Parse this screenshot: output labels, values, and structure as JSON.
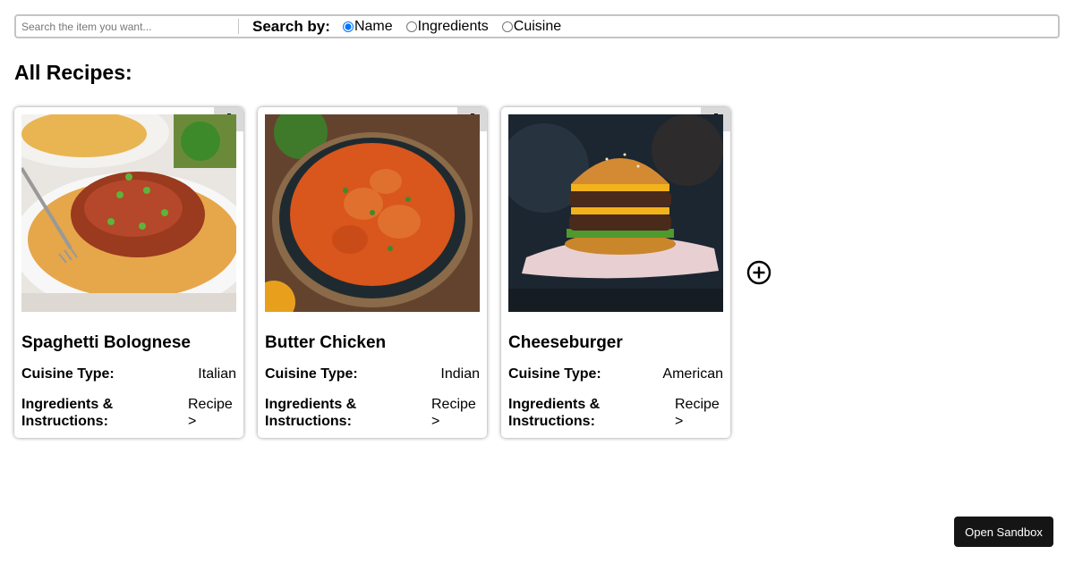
{
  "search": {
    "placeholder": "Search the item you want...",
    "value": "",
    "search_by_label": "Search by:",
    "options": [
      {
        "label": "Name",
        "selected": true
      },
      {
        "label": "Ingredients",
        "selected": false
      },
      {
        "label": "Cuisine",
        "selected": false
      }
    ]
  },
  "page_title": "All Recipes:",
  "labels": {
    "cuisine_type": "Cuisine Type:",
    "ingredients_instructions": "Ingredients & Instructions:",
    "recipe_link": "Recipe >"
  },
  "recipes": [
    {
      "name": "Spaghetti Bolognese",
      "cuisine": "Italian",
      "image": "spaghetti-bolognese-photo"
    },
    {
      "name": "Butter Chicken",
      "cuisine": "Indian",
      "image": "butter-chicken-photo"
    },
    {
      "name": "Cheeseburger",
      "cuisine": "American",
      "image": "cheeseburger-photo"
    }
  ],
  "icons": {
    "delete": "trash-icon",
    "add": "plus-circle-icon"
  },
  "sandbox_button": "Open Sandbox",
  "colors": {
    "accent": "#0075ff",
    "sandbox_bg": "#151515",
    "delete_bg": "#d9d9d9"
  }
}
